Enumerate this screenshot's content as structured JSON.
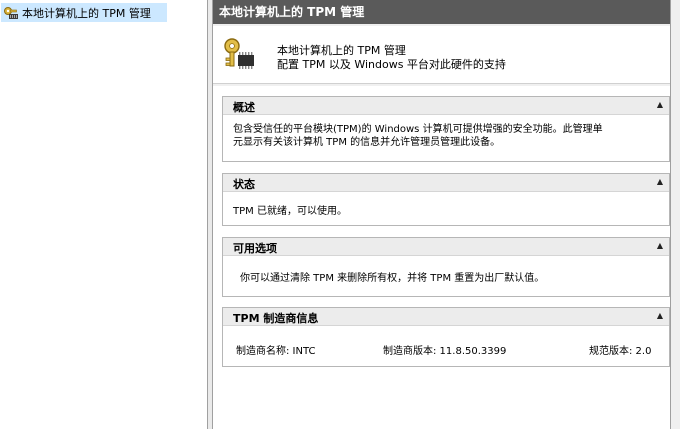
{
  "tree": {
    "item_label": "本地计算机上的 TPM 管理",
    "item_icon": "tpm-key-icon"
  },
  "right": {
    "title": "本地计算机上的 TPM 管理",
    "header": {
      "icon": "key-chip-icon",
      "line1": "本地计算机上的 TPM 管理",
      "line2": "配置 TPM 以及 Windows 平台对此硬件的支持"
    },
    "sections": [
      {
        "title": "概述",
        "toggle": "▲",
        "lines": [
          "包含受信任的平台模块(TPM)的 Windows 计算机可提供增强的安全功能。此管理单",
          "元显示有关该计算机 TPM 的信息并允许管理员管理此设备。"
        ]
      },
      {
        "title": "状态",
        "toggle": "▲",
        "text": "TPM 已就绪，可以使用。"
      },
      {
        "title": "可用选项",
        "toggle": "▲",
        "text": "你可以通过清除 TPM 来删除所有权，并将 TPM 重置为出厂默认值。"
      },
      {
        "title": "TPM 制造商信息",
        "toggle": "▲",
        "manufacturer_name": "制造商名称: INTC",
        "manufacturer_version": "制造商版本: 11.8.50.3399",
        "spec_version": "规范版本: 2.0"
      }
    ]
  },
  "colors": {
    "title_bar": "#5a5a5a",
    "tree_selection": "#cce8ff",
    "section_header": "#ececec",
    "section_border": "#b6b6b6"
  }
}
